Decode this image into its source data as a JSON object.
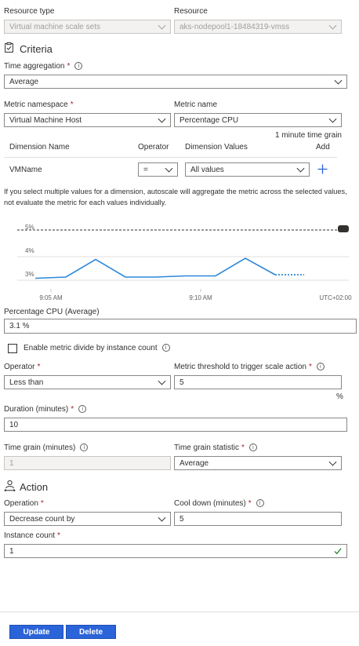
{
  "resource": {
    "type_label": "Resource type",
    "type_value": "Virtual machine scale sets",
    "resource_label": "Resource",
    "resource_value": "aks-nodepool1-18484319-vmss"
  },
  "criteria": {
    "title": "Criteria",
    "time_aggregation_label": "Time aggregation",
    "time_aggregation_value": "Average",
    "metric_namespace_label": "Metric namespace",
    "metric_namespace_value": "Virtual Machine Host",
    "metric_name_label": "Metric name",
    "metric_name_value": "Percentage CPU",
    "time_grain_note": "1 minute time grain",
    "dimension_headers": {
      "name": "Dimension Name",
      "operator": "Operator",
      "values": "Dimension Values",
      "add": "Add"
    },
    "dimension_row": {
      "name": "VMName",
      "operator": "=",
      "values": "All values"
    },
    "note": "If you select multiple values for a dimension, autoscale will aggregate the metric across the selected values, not evaluate the metric for each values individually."
  },
  "chart_data": {
    "type": "line",
    "y_ticks": [
      "5%",
      "4%",
      "3%"
    ],
    "x_ticks": [
      "9:05 AM",
      "9:10 AM",
      "UTC+02:00"
    ],
    "threshold": 5,
    "ylim": [
      2.95,
      5.1
    ],
    "x": [
      0,
      1,
      2,
      3,
      4,
      5,
      6,
      7,
      8
    ],
    "values": [
      2.95,
      3.0,
      3.75,
      3.0,
      3.0,
      3.05,
      3.05,
      3.8,
      3.1
    ],
    "dotted_tail": [
      3.1,
      3.1
    ],
    "series_color": "#2b88d8",
    "threshold_color": "#323130"
  },
  "percentage": {
    "label": "Percentage CPU (Average)",
    "value": "3.1 %"
  },
  "divide": {
    "label": "Enable metric divide by instance count"
  },
  "operator": {
    "label": "Operator",
    "value": "Less than"
  },
  "threshold": {
    "label": "Metric threshold to trigger scale action",
    "value": "5",
    "unit": "%"
  },
  "duration": {
    "label": "Duration (minutes)",
    "value": "10"
  },
  "time_grain": {
    "label": "Time grain (minutes)",
    "value": "1"
  },
  "time_grain_stat": {
    "label": "Time grain statistic",
    "value": "Average"
  },
  "action": {
    "title": "Action",
    "operation_label": "Operation",
    "operation_value": "Decrease count by",
    "cooldown_label": "Cool down (minutes)",
    "cooldown_value": "5",
    "instance_label": "Instance count",
    "instance_value": "1"
  },
  "buttons": {
    "update": "Update",
    "delete": "Delete"
  },
  "colors": {
    "primary": "#2b63d9",
    "required": "#a4262c",
    "valid_check": "#107c10"
  }
}
